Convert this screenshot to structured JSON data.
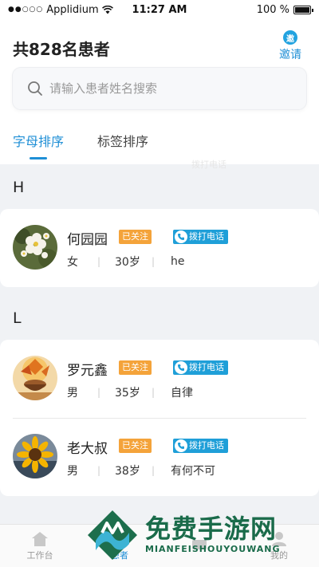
{
  "status_bar": {
    "carrier": "Applidium",
    "time": "11:27 AM",
    "battery": "100 %"
  },
  "header": {
    "title": "共828名患者",
    "invite_icon_char": "邀",
    "invite_label": "邀请"
  },
  "search": {
    "placeholder": "请输入患者姓名搜索"
  },
  "tabs": [
    {
      "label": "字母排序"
    },
    {
      "label": "标签排序"
    }
  ],
  "ghost_text": "拨打电话",
  "sections": [
    {
      "letter": "H",
      "patients": [
        {
          "name": "何园园",
          "follow": "已关注",
          "call": "拨打电话",
          "gender": "女",
          "age": "30岁",
          "tag": "he",
          "avatar": "flower-white-icon"
        }
      ]
    },
    {
      "letter": "L",
      "patients": [
        {
          "name": "罗元鑫",
          "follow": "已关注",
          "call": "拨打电话",
          "gender": "男",
          "age": "35岁",
          "tag": "自律",
          "avatar": "autumn-cup-icon"
        },
        {
          "name": "老大叔",
          "follow": "已关注",
          "call": "拨打电话",
          "gender": "男",
          "age": "38岁",
          "tag": "有何不可",
          "avatar": "sunflower-icon"
        }
      ]
    }
  ],
  "tabbar": [
    {
      "label": "工作台"
    },
    {
      "label": "患者"
    },
    {
      "label": ""
    },
    {
      "label": "我的"
    }
  ],
  "watermark": {
    "title": "免费手游网",
    "subtitle": "MIANFEISHOUYOUWANG"
  },
  "colors": {
    "accent": "#1f8fd6",
    "follow_badge": "#f4a33a",
    "call_badge": "#1f9fd8",
    "background": "#f0f2f5"
  }
}
